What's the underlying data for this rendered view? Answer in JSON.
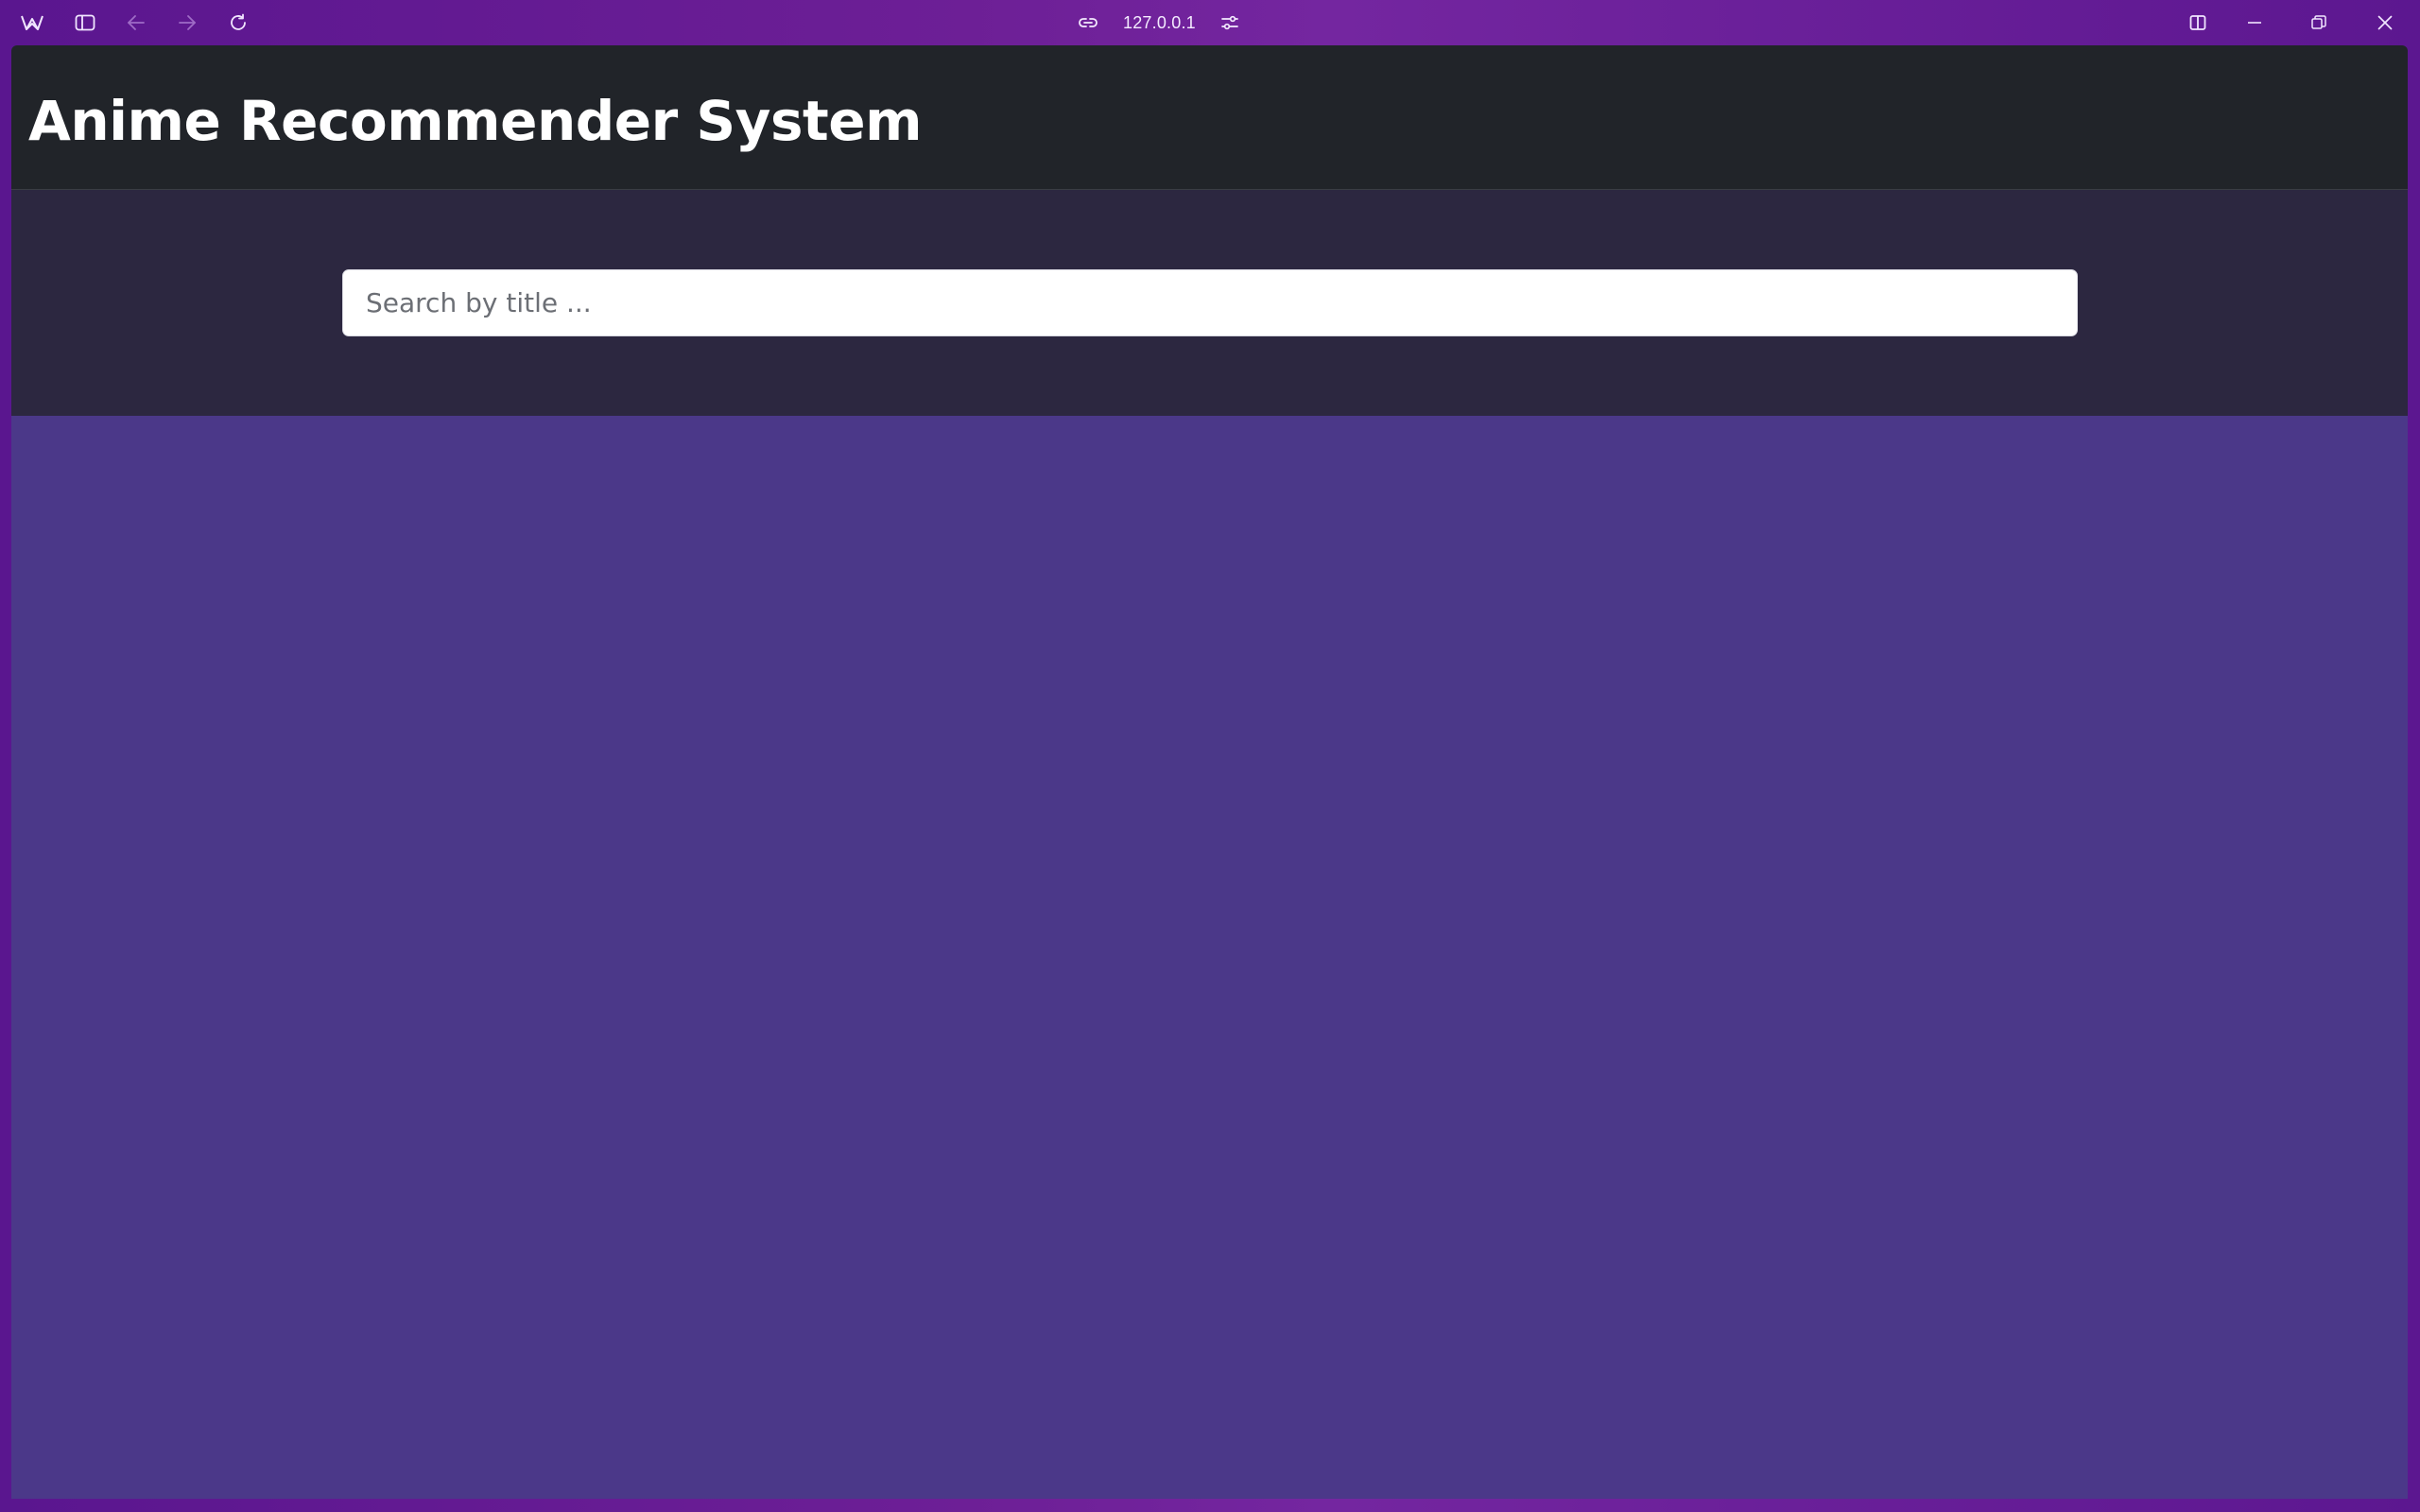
{
  "browser": {
    "address": "127.0.0.1",
    "icons": {
      "app": "browser-logo-icon",
      "sidebar": "sidebar-toggle-icon",
      "back": "back-arrow-icon",
      "forward": "forward-arrow-icon",
      "reload": "reload-icon",
      "link": "link-icon",
      "site_settings": "sliders-icon",
      "split_view": "split-view-icon",
      "minimize": "minimize-icon",
      "restore": "restore-icon",
      "close": "close-icon"
    },
    "accent": "#6d1f96"
  },
  "page": {
    "title": "Anime Recommender System",
    "search": {
      "placeholder": "Search by title ...",
      "value": ""
    },
    "colors": {
      "navbar": "#212429",
      "search_band": "#2c2740",
      "content": "#4b3889",
      "input": "#ffffff"
    }
  }
}
